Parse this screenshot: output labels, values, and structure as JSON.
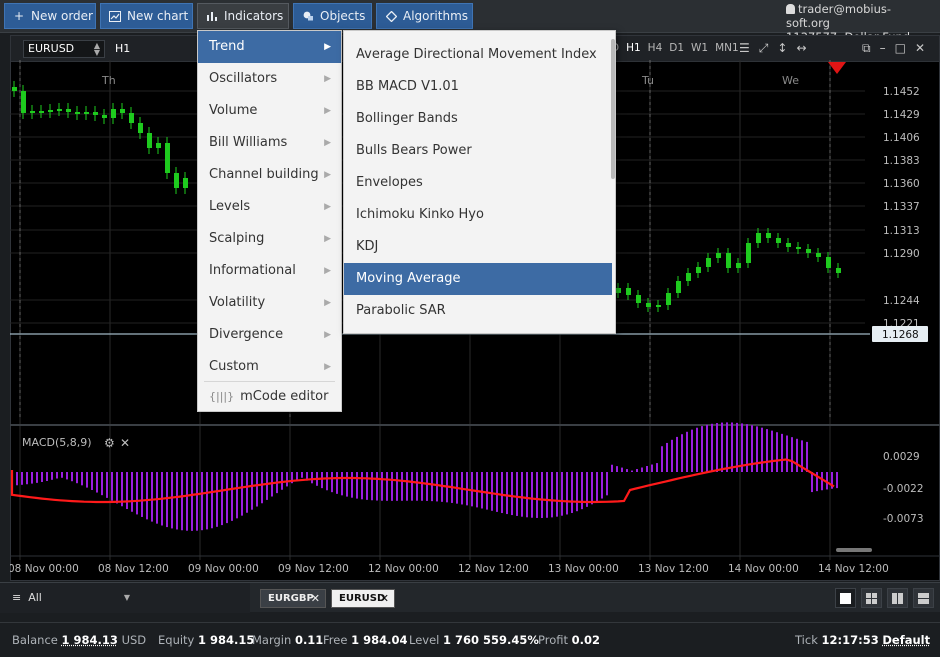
{
  "toolbar": {
    "new_order": "New order",
    "new_chart": "New chart",
    "indicators": "Indicators",
    "objects": "Objects",
    "algorithms": "Algorithms",
    "icons": {
      "new_order": "plus-icon",
      "new_chart": "chart-icon",
      "indicators": "bars-icon",
      "objects": "objects-icon",
      "algorithms": "diamond-icon"
    }
  },
  "account": {
    "user": "trader@mobius-soft.org",
    "id": "1137577",
    "name": "Dollar Fund"
  },
  "chart": {
    "symbol": "EURUSD",
    "timeframe": "H1",
    "timeframes": [
      "D",
      "H1",
      "H4",
      "D1",
      "W1",
      "MN1"
    ],
    "selected_timeframe": "H1",
    "day_labels": [
      "Th",
      "Tu",
      "We"
    ],
    "price_labels": [
      "1.1452",
      "1.1429",
      "1.1406",
      "1.1383",
      "1.1360",
      "1.1337",
      "1.1313",
      "1.1290",
      "1.1244",
      "1.1221"
    ],
    "current_price": "1.1268",
    "macd_label": "MACD(5,8,9)",
    "macd_labels": [
      "0.0029",
      "-0.0022",
      "-0.0073"
    ],
    "time_labels": [
      "08 Nov 00:00",
      "08 Nov 12:00",
      "09 Nov 00:00",
      "09 Nov 12:00",
      "12 Nov 00:00",
      "12 Nov 12:00",
      "13 Nov 00:00",
      "13 Nov 12:00",
      "14 Nov 00:00",
      "14 Nov 12:00"
    ],
    "colors": {
      "bull": "#1ecb1e",
      "bear": "#1ecb1e",
      "macd_hist": "#9a1ee0",
      "signal": "#ff1a1a",
      "price_line": "#9fb7c4"
    }
  },
  "menu": {
    "categories": [
      "Trend",
      "Oscillators",
      "Volume",
      "Bill Williams",
      "Channel building",
      "Levels",
      "Scalping",
      "Informational",
      "Volatility",
      "Divergence",
      "Custom"
    ],
    "selected_category": "Trend",
    "editor": "mCode editor",
    "trend_items": [
      "Average Directional Movement Index",
      "BB MACD V1.01",
      "Bollinger Bands",
      "Bulls Bears Power",
      "Envelopes",
      "Ichimoku Kinko Hyo",
      "KDJ",
      "Moving Average",
      "Parabolic SAR"
    ],
    "selected_item": "Moving Average"
  },
  "tabs": {
    "filter": "All",
    "symbols": [
      "EURGBP",
      "EURUSD"
    ],
    "active": "EURUSD"
  },
  "status": {
    "balance_label": "Balance",
    "balance": "1 984.13",
    "currency": "USD",
    "equity_label": "Equity",
    "equity": "1 984.15",
    "margin_label": "Margin",
    "margin": "0.11",
    "free_label": "Free",
    "free": "1 984.04",
    "level_label": "Level",
    "level": "1 760 559.45%",
    "profit_label": "Profit",
    "profit": "0.02",
    "tick_label": "Tick",
    "tick": "12:17:53",
    "tick_mode": "Default"
  }
}
